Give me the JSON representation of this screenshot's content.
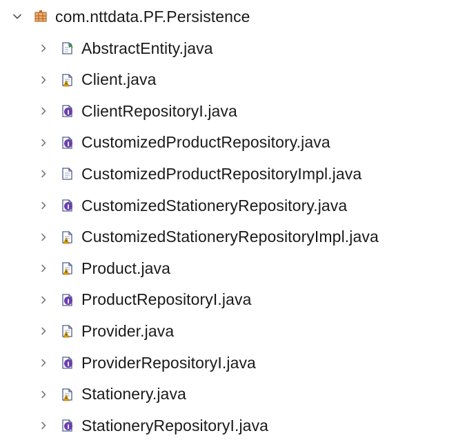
{
  "package": {
    "label": "com.nttdata.PF.Persistence",
    "expanded": true,
    "icon": "package-icon"
  },
  "files": [
    {
      "label": "AbstractEntity.java",
      "icon": "abstract-class-icon"
    },
    {
      "label": "Client.java",
      "icon": "class-warning-icon"
    },
    {
      "label": "ClientRepositoryI.java",
      "icon": "interface-icon"
    },
    {
      "label": "CustomizedProductRepository.java",
      "icon": "interface-icon"
    },
    {
      "label": "CustomizedProductRepositoryImpl.java",
      "icon": "class-icon"
    },
    {
      "label": "CustomizedStationeryRepository.java",
      "icon": "interface-icon"
    },
    {
      "label": "CustomizedStationeryRepositoryImpl.java",
      "icon": "class-warning-icon"
    },
    {
      "label": "Product.java",
      "icon": "class-warning-icon"
    },
    {
      "label": "ProductRepositoryI.java",
      "icon": "interface-icon"
    },
    {
      "label": "Provider.java",
      "icon": "class-warning-icon"
    },
    {
      "label": "ProviderRepositoryI.java",
      "icon": "interface-icon"
    },
    {
      "label": "Stationery.java",
      "icon": "class-warning-icon"
    },
    {
      "label": "StationeryRepositoryI.java",
      "icon": "interface-icon"
    }
  ],
  "colors": {
    "chevron": "#5a5a5a",
    "file_outline": "#4f5d8a",
    "interface_badge": "#6a3fb0",
    "warning_badge": "#e2a300",
    "abstract_badge": "#2f8f3a",
    "package_brown": "#b46a32"
  }
}
